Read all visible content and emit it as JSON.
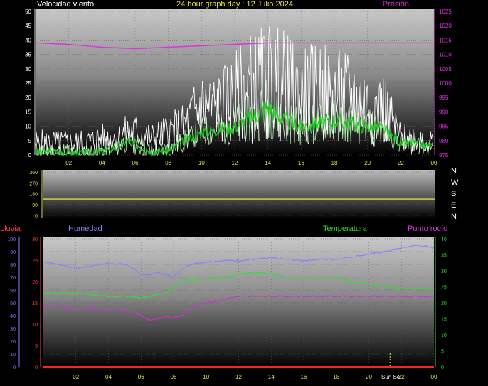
{
  "header": {
    "wind_label": "Velocidad viento",
    "title": "24 hour graph day : 12 Julio 2024",
    "pressure_label": "Presión"
  },
  "labels": {
    "rain": "Lluvia",
    "humidity": "Humedad",
    "temperature": "Temperatura",
    "dewpoint": "Punto rocío",
    "sunset": "Sun Set",
    "compass": [
      "N",
      "W",
      "S",
      "E",
      "N"
    ]
  },
  "colors": {
    "wind": "#ffffff",
    "wind_avg": "#22cc22",
    "wind_light": "#b8f0b8",
    "pressure": "#dd33dd",
    "direction": "#e0e040",
    "humidity": "#8080ff",
    "temperature": "#33dd33",
    "dewpoint": "#cc33cc",
    "rain": "#ff2222",
    "axis_yellow": "#e0e040",
    "axis_left3": "#ff4040"
  },
  "chart_data": [
    {
      "type": "line",
      "name": "wind_pressure",
      "title": "24 hour graph day : 12 Julio 2024",
      "x_ticks": [
        "02",
        "04",
        "06",
        "08",
        "10",
        "12",
        "14",
        "16",
        "18",
        "20",
        "22",
        "00"
      ],
      "y_left": {
        "label": "Velocidad viento",
        "ticks": [
          0,
          5,
          10,
          15,
          20,
          25,
          30,
          35,
          40,
          45,
          50
        ],
        "ylim": [
          0,
          50
        ]
      },
      "y_right": {
        "label": "Presión",
        "ticks": [
          975,
          980,
          985,
          990,
          995,
          1000,
          1005,
          1010,
          1015,
          1020,
          1025
        ],
        "ylim": [
          975,
          1025
        ]
      },
      "xlim": [
        0,
        24
      ],
      "series": [
        {
          "name": "gust",
          "color": "#ffffff",
          "x": [
            0,
            1,
            2,
            3,
            4,
            5,
            5.5,
            6,
            7,
            8,
            9,
            9.5,
            10,
            11,
            12,
            13,
            13.5,
            14,
            15,
            16,
            17,
            18,
            19,
            20,
            21,
            22,
            23,
            24
          ],
          "y": [
            4,
            4,
            4,
            4,
            6,
            6,
            8,
            8,
            6,
            8,
            10,
            14,
            17,
            16,
            20,
            24,
            24,
            26,
            24,
            20,
            22,
            20,
            20,
            17,
            16,
            6,
            6,
            4
          ]
        },
        {
          "name": "average",
          "color": "#22cc22",
          "x": [
            0,
            1,
            2,
            3,
            4,
            5,
            5.5,
            6,
            7,
            8,
            9,
            10,
            11,
            12,
            13,
            14,
            15,
            16,
            17,
            18,
            19,
            20,
            21,
            22,
            23,
            24
          ],
          "y": [
            1,
            1,
            1,
            0.5,
            1,
            3,
            5,
            4,
            1,
            2,
            5,
            8,
            9,
            10,
            13,
            17,
            12,
            10,
            11,
            12,
            11,
            10,
            9,
            4,
            4,
            3
          ]
        },
        {
          "name": "pressure",
          "color": "#dd33dd",
          "x": [
            0,
            2,
            4,
            6,
            8,
            10,
            12,
            14,
            16,
            18,
            20,
            22,
            24
          ],
          "y": [
            1014,
            1013.5,
            1012.5,
            1012,
            1012.5,
            1013,
            1013.5,
            1014,
            1014,
            1014,
            1014,
            1014,
            1014
          ]
        }
      ]
    },
    {
      "type": "line",
      "name": "wind_direction",
      "y_left": {
        "ticks": [
          0,
          90,
          180,
          270,
          360
        ],
        "ylim": [
          0,
          360
        ]
      },
      "xlim": [
        0,
        24
      ],
      "series": [
        {
          "name": "direction",
          "color": "#e0e040",
          "x": [
            0,
            24
          ],
          "y": [
            135,
            135
          ]
        }
      ]
    },
    {
      "type": "line",
      "name": "rain_humidity_temp",
      "x_ticks": [
        "02",
        "04",
        "06",
        "08",
        "10",
        "12",
        "14",
        "16",
        "18",
        "20",
        "22",
        "00"
      ],
      "y_axis_rain": {
        "label": "Lluvia",
        "ticks": [
          0,
          10,
          20,
          30,
          40,
          50,
          60,
          70,
          80,
          90,
          100
        ],
        "ylim": [
          0,
          100
        ]
      },
      "y_axis_humidity": {
        "label": "Humedad",
        "ticks": [
          0,
          5,
          10,
          15,
          20,
          25,
          30
        ],
        "ylim": [
          0,
          30
        ]
      },
      "y_axis_temperature": {
        "label": "Temperatura",
        "ticks": [
          0,
          5,
          10,
          15,
          20,
          25,
          30,
          35,
          40
        ],
        "ylim": [
          0,
          40
        ]
      },
      "xlim": [
        0,
        24
      ],
      "markers": [
        {
          "x": 6.8,
          "label": ""
        },
        {
          "x": 21.3,
          "label": "Sun Set"
        }
      ],
      "series": [
        {
          "name": "Humedad",
          "color": "#8080ff",
          "axis": "rain",
          "x": [
            0,
            1,
            2,
            3,
            4,
            5,
            5.7,
            6,
            6.5,
            7,
            7.5,
            8,
            8.5,
            9,
            10,
            11,
            12,
            13,
            14,
            15,
            16,
            17,
            18,
            19,
            20,
            21,
            22,
            23,
            24
          ],
          "y": [
            82,
            80,
            77,
            79,
            81,
            80,
            76,
            71,
            72,
            74,
            72,
            70,
            76,
            80,
            82,
            83,
            83,
            84,
            85,
            84,
            83,
            84,
            84,
            86,
            88,
            90,
            93,
            95,
            93
          ]
        },
        {
          "name": "Temperatura",
          "color": "#33dd33",
          "axis": "temperature",
          "x": [
            0,
            1,
            2,
            3,
            4,
            5,
            6,
            7,
            7.5,
            8,
            8.5,
            9,
            10,
            11,
            12,
            13,
            14,
            15,
            16,
            17,
            18,
            19,
            20,
            21,
            22,
            23,
            24
          ],
          "y": [
            23,
            23,
            23,
            22.5,
            22,
            22,
            21.5,
            22.5,
            23,
            25,
            27,
            27,
            27.5,
            28,
            29,
            29.5,
            29,
            28,
            28,
            28,
            28,
            26.5,
            26,
            25,
            24.5,
            24.5,
            24.5
          ]
        },
        {
          "name": "Punto rocío",
          "color": "#cc33cc",
          "axis": "temperature",
          "x": [
            0,
            1,
            2,
            3,
            4,
            5,
            6,
            6.5,
            7,
            7.5,
            8,
            8.5,
            9,
            10,
            11,
            12,
            13,
            14,
            15,
            16,
            17,
            18,
            19,
            20,
            21,
            22,
            23,
            24
          ],
          "y": [
            19,
            19,
            18,
            18.5,
            18,
            18,
            16,
            14.5,
            15,
            15.5,
            15.5,
            16,
            18.5,
            20,
            21,
            22,
            22,
            22,
            22,
            22,
            22,
            22,
            22,
            22,
            22,
            22,
            22,
            22
          ]
        },
        {
          "name": "Lluvia",
          "color": "#ff2222",
          "axis": "rain",
          "x": [
            0,
            24
          ],
          "y": [
            0,
            0
          ]
        }
      ]
    }
  ]
}
